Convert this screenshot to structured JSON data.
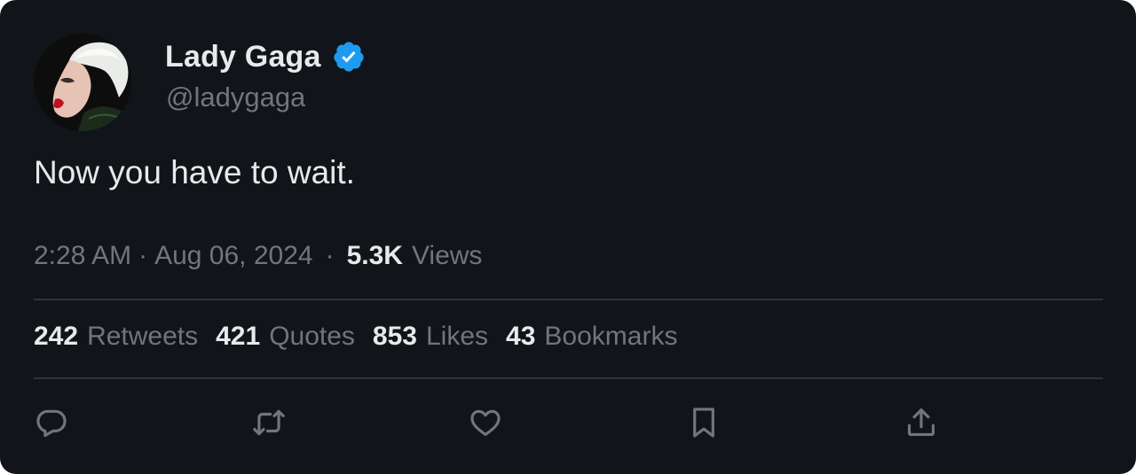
{
  "author": {
    "display_name": "Lady Gaga",
    "handle": "@ladygaga",
    "verified": true,
    "avatar_icon": "avatar-portrait"
  },
  "tweet": {
    "text": "Now you have to wait.",
    "time": "2:28 AM",
    "separator": "·",
    "date": "Aug 06, 2024",
    "views_count": "5.3K",
    "views_label": "Views"
  },
  "stats": [
    {
      "count": "242",
      "label": "Retweets"
    },
    {
      "count": "421",
      "label": "Quotes"
    },
    {
      "count": "853",
      "label": "Likes"
    },
    {
      "count": "43",
      "label": "Bookmarks"
    }
  ],
  "actions": [
    {
      "name": "reply",
      "icon": "reply-icon"
    },
    {
      "name": "retweet",
      "icon": "retweet-icon"
    },
    {
      "name": "like",
      "icon": "heart-icon"
    },
    {
      "name": "bookmark",
      "icon": "bookmark-icon"
    },
    {
      "name": "share",
      "icon": "share-icon"
    }
  ],
  "colors": {
    "background": "#111418",
    "text_primary": "#e7e9ea",
    "text_secondary": "#71767b",
    "verified_blue": "#1d9bf0",
    "divider": "#2f3336"
  }
}
